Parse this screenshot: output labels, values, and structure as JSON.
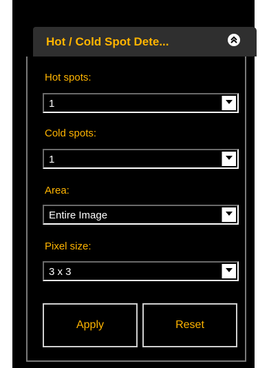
{
  "panel": {
    "title": "Hot / Cold Spot Dete...",
    "accent_color": "#ffb400",
    "collapse_icon": "double-chevron-up-icon"
  },
  "fields": [
    {
      "label": "Hot spots:",
      "value": "1"
    },
    {
      "label": "Cold spots:",
      "value": "1"
    },
    {
      "label": "Area:",
      "value": "Entire Image"
    },
    {
      "label": "Pixel size:",
      "value": "3 x 3"
    }
  ],
  "buttons": {
    "apply": "Apply",
    "reset": "Reset"
  }
}
